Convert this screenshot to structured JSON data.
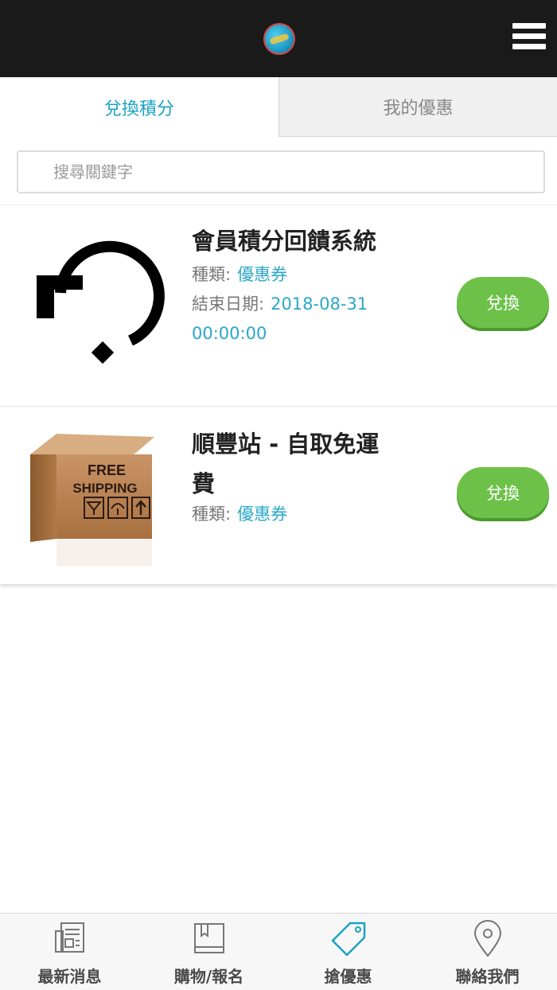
{
  "header": {
    "logo_icon": "site-logo",
    "menu_icon": "hamburger-menu-icon"
  },
  "tabs": [
    {
      "label": "兌換積分",
      "active": true
    },
    {
      "label": "我的優惠",
      "active": false
    }
  ],
  "search": {
    "placeholder": "搜尋關鍵字"
  },
  "items": [
    {
      "title": "會員積分回饋系統",
      "type_label": "種類:",
      "type_value": "優惠券",
      "end_label": "結束日期:",
      "end_value": "2018-08-31",
      "end_time": "00:00:00",
      "button_label": "兌換",
      "image_icon": "undo-arrow-icon"
    },
    {
      "title": "順豐站 - 自取免運費",
      "type_label": "種類:",
      "type_value": "優惠券",
      "button_label": "兌換",
      "image_text_1": "FREE",
      "image_text_2": "SHIPPING",
      "image_icon": "free-shipping-box-icon"
    }
  ],
  "bottom_nav": [
    {
      "label": "最新消息",
      "icon": "news-icon",
      "active": false
    },
    {
      "label": "購物/報名",
      "icon": "book-icon",
      "active": false
    },
    {
      "label": "搶優惠",
      "icon": "tag-icon",
      "active": true
    },
    {
      "label": "聯絡我們",
      "icon": "location-pin-icon",
      "active": false
    }
  ],
  "colors": {
    "header_bg": "#1a1a1a",
    "accent": "#1aa3c4",
    "button_green": "#6dc149",
    "link_blue": "#2aa7c8"
  }
}
